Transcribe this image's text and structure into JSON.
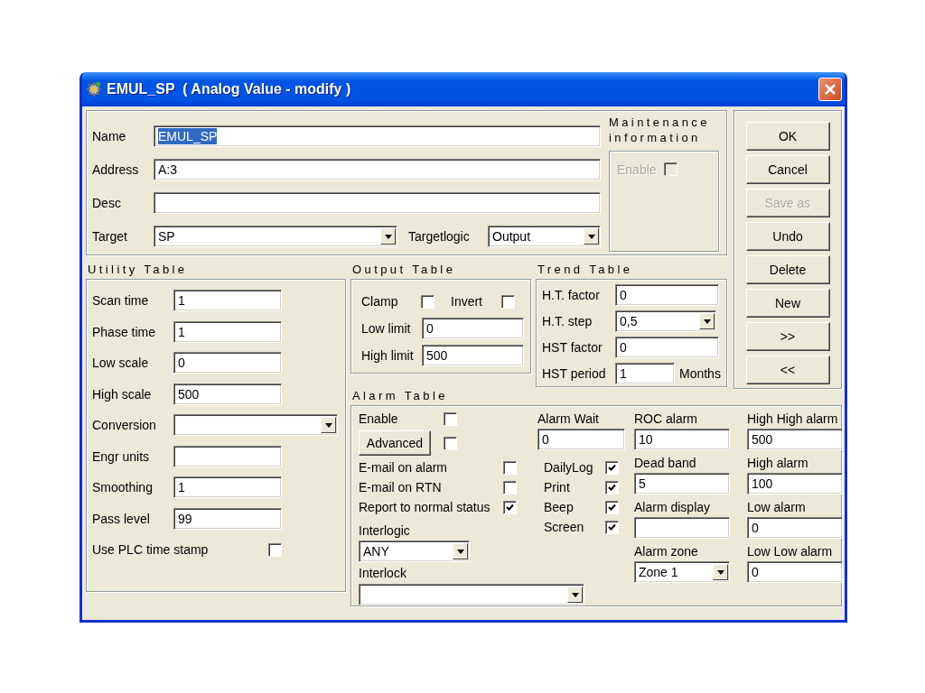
{
  "window": {
    "title": "EMUL_SP  ( Analog Value - modify )"
  },
  "general": {
    "fields": [
      {
        "label": "Name",
        "value": "EMUL_SP",
        "text_selected": true
      },
      {
        "label": "Address",
        "value": "A:3",
        "text_selected": false
      },
      {
        "label": "Desc"
      }
    ],
    "target": {
      "label": "Target",
      "value": "SP"
    },
    "targetlogic": {
      "label": "Targetlogic",
      "value": "Output"
    }
  },
  "maintenance": {
    "title": "Maintenance information",
    "enable": {
      "label": "Enable",
      "checked": false,
      "disabled": true
    }
  },
  "buttons": [
    {
      "label": "OK",
      "disabled": false
    },
    {
      "label": "Cancel",
      "disabled": false
    },
    {
      "label": "Save as",
      "disabled": true
    },
    {
      "label": "Undo",
      "disabled": false
    },
    {
      "label": "Delete",
      "disabled": false
    },
    {
      "label": "New",
      "disabled": false
    },
    {
      "label": ">>",
      "disabled": false
    },
    {
      "label": "<<",
      "disabled": false
    }
  ],
  "utility_table": {
    "title": "Utility Table",
    "rows": [
      {
        "kind": "text",
        "label": "Scan time",
        "value": "1"
      },
      {
        "kind": "text",
        "label": "Phase time",
        "value": "1"
      },
      {
        "kind": "text",
        "label": "Low scale",
        "value": "0"
      },
      {
        "kind": "text",
        "label": "High scale",
        "value": "500"
      },
      {
        "kind": "combo",
        "label": "Conversion"
      },
      {
        "kind": "text",
        "label": "Engr units"
      },
      {
        "kind": "text",
        "label": "Smoothing",
        "value": "1"
      },
      {
        "kind": "text",
        "label": "Pass level",
        "value": "99"
      },
      {
        "kind": "check",
        "label": "Use PLC time stamp",
        "checked": false
      }
    ]
  },
  "output_table": {
    "title": "Output Table",
    "checks": [
      {
        "label": "Clamp",
        "checked": false
      },
      {
        "label": "Invert",
        "checked": false
      }
    ],
    "fields": [
      {
        "label": "Low limit",
        "value": "0"
      },
      {
        "label": "High limit",
        "value": "500"
      }
    ]
  },
  "trend_table": {
    "title": "Trend Table",
    "rows": [
      {
        "kind": "text",
        "label": "H.T. factor",
        "value": "0"
      },
      {
        "kind": "combo",
        "label": "H.T. step",
        "value": "0,5"
      },
      {
        "kind": "text",
        "label": "HST factor",
        "value": "0"
      },
      {
        "kind": "text",
        "label": "HST period",
        "value": "1",
        "unit": "Months"
      }
    ]
  },
  "alarm_table": {
    "title": "Alarm Table",
    "enable": {
      "label": "Enable",
      "checked": false
    },
    "advanced": {
      "label": "Advanced",
      "checked": false
    },
    "options": [
      {
        "label": "E-mail on alarm",
        "checked": false
      },
      {
        "label": "E-mail on RTN",
        "checked": false
      },
      {
        "label": "Report to normal status",
        "checked": true
      }
    ],
    "interlogic": {
      "label": "Interlogic",
      "value": "ANY"
    },
    "interlock": {
      "label": "Interlock"
    },
    "alarm_wait": {
      "label": "Alarm Wait",
      "value": "0"
    },
    "outputs": [
      {
        "label": "DailyLog",
        "checked": true
      },
      {
        "label": "Print",
        "checked": true
      },
      {
        "label": "Beep",
        "checked": true
      },
      {
        "label": "Screen",
        "checked": true
      }
    ],
    "column_3": [
      {
        "kind": "text",
        "label": "ROC alarm",
        "value": "10"
      },
      {
        "kind": "text",
        "label": "Dead band",
        "value": "5"
      },
      {
        "kind": "text",
        "label": "Alarm display"
      },
      {
        "kind": "combo",
        "label": "Alarm zone",
        "value": "Zone 1"
      }
    ],
    "limits": [
      {
        "kind": "text",
        "label": "High High alarm",
        "value": "500"
      },
      {
        "kind": "text",
        "label": "High alarm",
        "value": "100"
      },
      {
        "kind": "text",
        "label": "Low alarm",
        "value": "0"
      },
      {
        "kind": "text",
        "label": "Low Low alarm",
        "value": "0"
      }
    ]
  }
}
